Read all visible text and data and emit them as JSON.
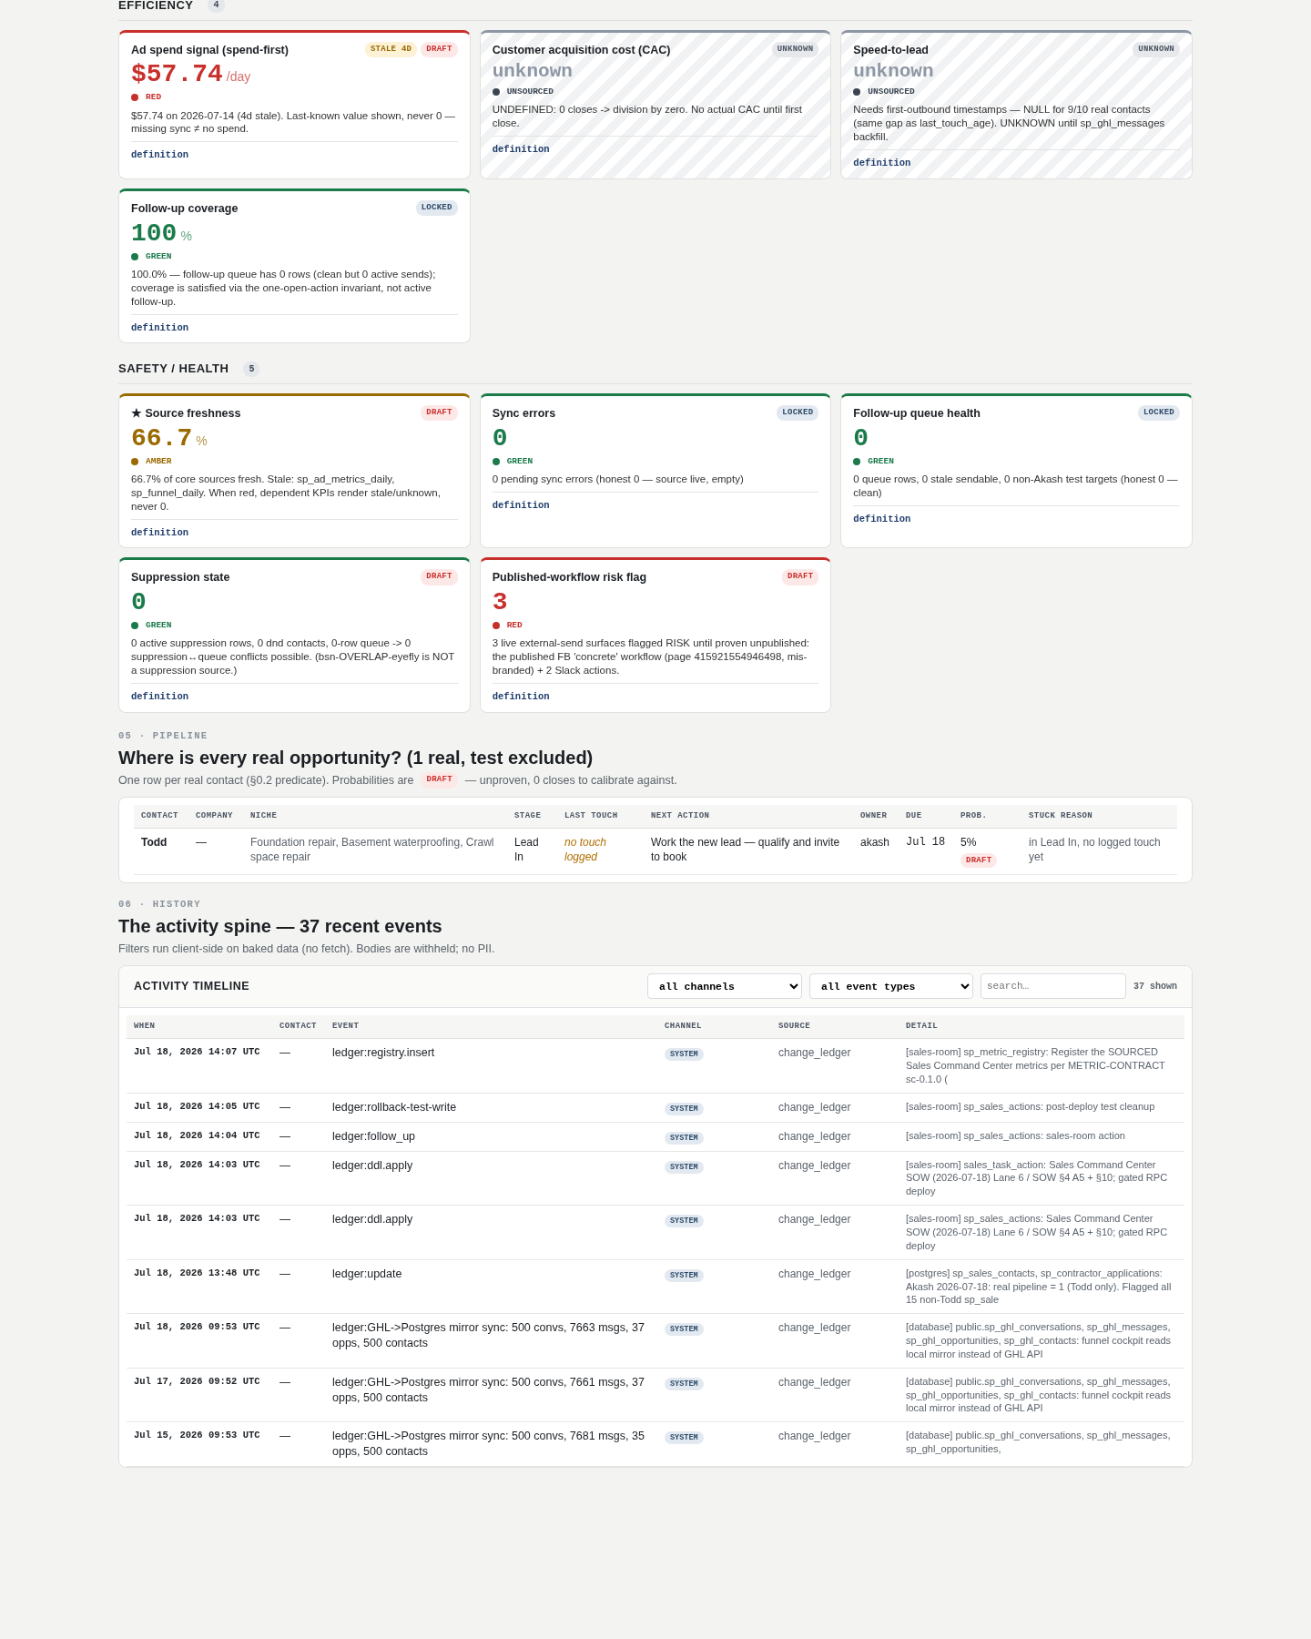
{
  "metric_sections": [
    {
      "title": "EFFICIENCY",
      "count": "4",
      "cards": [
        {
          "title": "Ad spend signal (spend-first)",
          "badges": [
            {
              "label": "STALE 4D",
              "kind": "stale"
            },
            {
              "label": "DRAFT",
              "kind": "draft"
            }
          ],
          "value": "$57.74",
          "unit": "/day",
          "status": {
            "label": "RED",
            "kind": "red"
          },
          "note": "$57.74 on 2026-07-14 (4d stale). Last-known value shown, never 0 — missing sync ≠ no spend.",
          "link": "definition"
        },
        {
          "title": "Customer acquisition cost (CAC)",
          "badges": [
            {
              "label": "UNKNOWN",
              "kind": "unknown"
            }
          ],
          "value": "unknown",
          "status": {
            "label": "UNSOURCED",
            "kind": "unsourced"
          },
          "note": "UNDEFINED: 0 closes -> division by zero. No actual CAC until first close.",
          "link": "definition"
        },
        {
          "title": "Speed-to-lead",
          "badges": [
            {
              "label": "UNKNOWN",
              "kind": "unknown"
            }
          ],
          "value": "unknown",
          "status": {
            "label": "UNSOURCED",
            "kind": "unsourced"
          },
          "note": "Needs first-outbound timestamps — NULL for 9/10 real contacts (same gap as last_touch_age). UNKNOWN until sp_ghl_messages backfill.",
          "link": "definition"
        },
        {
          "title": "Follow-up coverage",
          "badges": [
            {
              "label": "LOCKED",
              "kind": "locked"
            }
          ],
          "value": "100",
          "unit": "%",
          "status": {
            "label": "GREEN",
            "kind": "green"
          },
          "note": "100.0% — follow-up queue has 0 rows (clean but 0 active sends); coverage is satisfied via the one-open-action invariant, not active follow-up.",
          "link": "definition"
        }
      ]
    },
    {
      "title": "SAFETY / HEALTH",
      "count": "5",
      "cards": [
        {
          "title": "★ Source freshness",
          "badges": [
            {
              "label": "DRAFT",
              "kind": "draft"
            }
          ],
          "value": "66.7",
          "unit": "%",
          "status": {
            "label": "AMBER",
            "kind": "amber"
          },
          "note": "66.7% of core sources fresh. Stale: sp_ad_metrics_daily, sp_funnel_daily. When red, dependent KPIs render stale/unknown, never 0.",
          "link": "definition"
        },
        {
          "title": "Sync errors",
          "badges": [
            {
              "label": "LOCKED",
              "kind": "locked"
            }
          ],
          "value": "0",
          "status": {
            "label": "GREEN",
            "kind": "green"
          },
          "note": "0 pending sync errors (honest 0 — source live, empty)",
          "link": "definition"
        },
        {
          "title": "Follow-up queue health",
          "badges": [
            {
              "label": "LOCKED",
              "kind": "locked"
            }
          ],
          "value": "0",
          "status": {
            "label": "GREEN",
            "kind": "green"
          },
          "note": "0 queue rows, 0 stale sendable, 0 non-Akash test targets (honest 0 — clean)",
          "link": "definition"
        },
        {
          "title": "Suppression state",
          "badges": [
            {
              "label": "DRAFT",
              "kind": "draft"
            }
          ],
          "value": "0",
          "status": {
            "label": "GREEN",
            "kind": "green"
          },
          "note": "0 active suppression rows, 0 dnd contacts, 0-row queue -> 0 suppression↔queue conflicts possible. (bsn-OVERLAP-eyefly is NOT a suppression source.)",
          "link": "definition"
        },
        {
          "title": "Published-workflow risk flag",
          "badges": [
            {
              "label": "DRAFT",
              "kind": "draft"
            }
          ],
          "value": "3",
          "status": {
            "label": "RED",
            "kind": "red"
          },
          "note": "3 live external-send surfaces flagged RISK until proven unpublished: the published FB 'concrete' workflow (page 415921554946498, mis-branded) + 2 Slack actions.",
          "link": "definition"
        }
      ]
    }
  ],
  "pipeline": {
    "eyebrow": "05 · PIPELINE",
    "heading": "Where is every real opportunity? (1 real, test excluded)",
    "subtitle": {
      "before": "One row per real contact (§0.2 predicate). Probabilities are",
      "badge": "DRAFT",
      "after": "— unproven, 0 closes to calibrate against."
    },
    "columns": [
      "CONTACT",
      "COMPANY",
      "NICHE",
      "STAGE",
      "LAST TOUCH",
      "NEXT ACTION",
      "OWNER",
      "DUE",
      "PROB.",
      "STUCK REASON"
    ],
    "rows": [
      {
        "contact": "Todd",
        "company": "—",
        "niche": "Foundation repair, Basement waterproofing, Crawl space repair",
        "stage": "Lead In",
        "last_touch": "no touch logged",
        "next_action": "Work the new lead — qualify and invite to book",
        "owner": "akash",
        "due": "Jul 18",
        "prob": "5%",
        "prob_badge": "DRAFT",
        "stuck_reason": "in Lead In, no logged touch yet"
      }
    ]
  },
  "history": {
    "eyebrow": "06 · HISTORY",
    "heading": "The activity spine — 37 recent events",
    "subtitle": "Filters run client-side on baked data (no fetch). Bodies are withheld; no PII.",
    "panel_title": "ACTIVITY TIMELINE",
    "channel_filter": "all channels",
    "type_filter": "all event types",
    "search": {
      "placeholder": "search…"
    },
    "shown": "37 shown",
    "columns": [
      "WHEN",
      "CONTACT",
      "EVENT",
      "CHANNEL",
      "SOURCE",
      "DETAIL"
    ],
    "rows": [
      {
        "when": "Jul 18, 2026 14:07 UTC",
        "contact": "—",
        "event": "ledger:registry.insert",
        "channel": "SYSTEM",
        "source": "change_ledger",
        "detail": "[sales-room] sp_metric_registry: Register the SOURCED Sales Command Center metrics per METRIC-CONTRACT sc-0.1.0 ("
      },
      {
        "when": "Jul 18, 2026 14:05 UTC",
        "contact": "—",
        "event": "ledger:rollback-test-write",
        "channel": "SYSTEM",
        "source": "change_ledger",
        "detail": "[sales-room] sp_sales_actions: post-deploy test cleanup"
      },
      {
        "when": "Jul 18, 2026 14:04 UTC",
        "contact": "—",
        "event": "ledger:follow_up",
        "channel": "SYSTEM",
        "source": "change_ledger",
        "detail": "[sales-room] sp_sales_actions: sales-room action"
      },
      {
        "when": "Jul 18, 2026 14:03 UTC",
        "contact": "—",
        "event": "ledger:ddl.apply",
        "channel": "SYSTEM",
        "source": "change_ledger",
        "detail": "[sales-room] sales_task_action: Sales Command Center SOW (2026-07-18) Lane 6 / SOW §4 A5 + §10; gated RPC deploy"
      },
      {
        "when": "Jul 18, 2026 14:03 UTC",
        "contact": "—",
        "event": "ledger:ddl.apply",
        "channel": "SYSTEM",
        "source": "change_ledger",
        "detail": "[sales-room] sp_sales_actions: Sales Command Center SOW (2026-07-18) Lane 6 / SOW §4 A5 + §10; gated RPC deploy"
      },
      {
        "when": "Jul 18, 2026 13:48 UTC",
        "contact": "—",
        "event": "ledger:update",
        "channel": "SYSTEM",
        "source": "change_ledger",
        "detail": "[postgres] sp_sales_contacts, sp_contractor_applications: Akash 2026-07-18: real pipeline = 1 (Todd only). Flagged all 15 non-Todd sp_sale"
      },
      {
        "when": "Jul 18, 2026 09:53 UTC",
        "contact": "—",
        "event": "ledger:GHL->Postgres mirror sync: 500 convs, 7663 msgs, 37 opps, 500 contacts",
        "channel": "SYSTEM",
        "source": "change_ledger",
        "detail": "[database] public.sp_ghl_conversations, sp_ghl_messages, sp_ghl_opportunities, sp_ghl_contacts: funnel cockpit reads local mirror instead of GHL API"
      },
      {
        "when": "Jul 17, 2026 09:52 UTC",
        "contact": "—",
        "event": "ledger:GHL->Postgres mirror sync: 500 convs, 7661 msgs, 37 opps, 500 contacts",
        "channel": "SYSTEM",
        "source": "change_ledger",
        "detail": "[database] public.sp_ghl_conversations, sp_ghl_messages, sp_ghl_opportunities, sp_ghl_contacts: funnel cockpit reads local mirror instead of GHL API"
      },
      {
        "when": "Jul 15, 2026 09:53 UTC",
        "contact": "—",
        "event": "ledger:GHL->Postgres mirror sync: 500 convs, 7681 msgs, 35 opps, 500 contacts",
        "channel": "SYSTEM",
        "source": "change_ledger",
        "detail": "[database] public.sp_ghl_conversations, sp_ghl_messages, sp_ghl_opportunities,"
      }
    ]
  }
}
